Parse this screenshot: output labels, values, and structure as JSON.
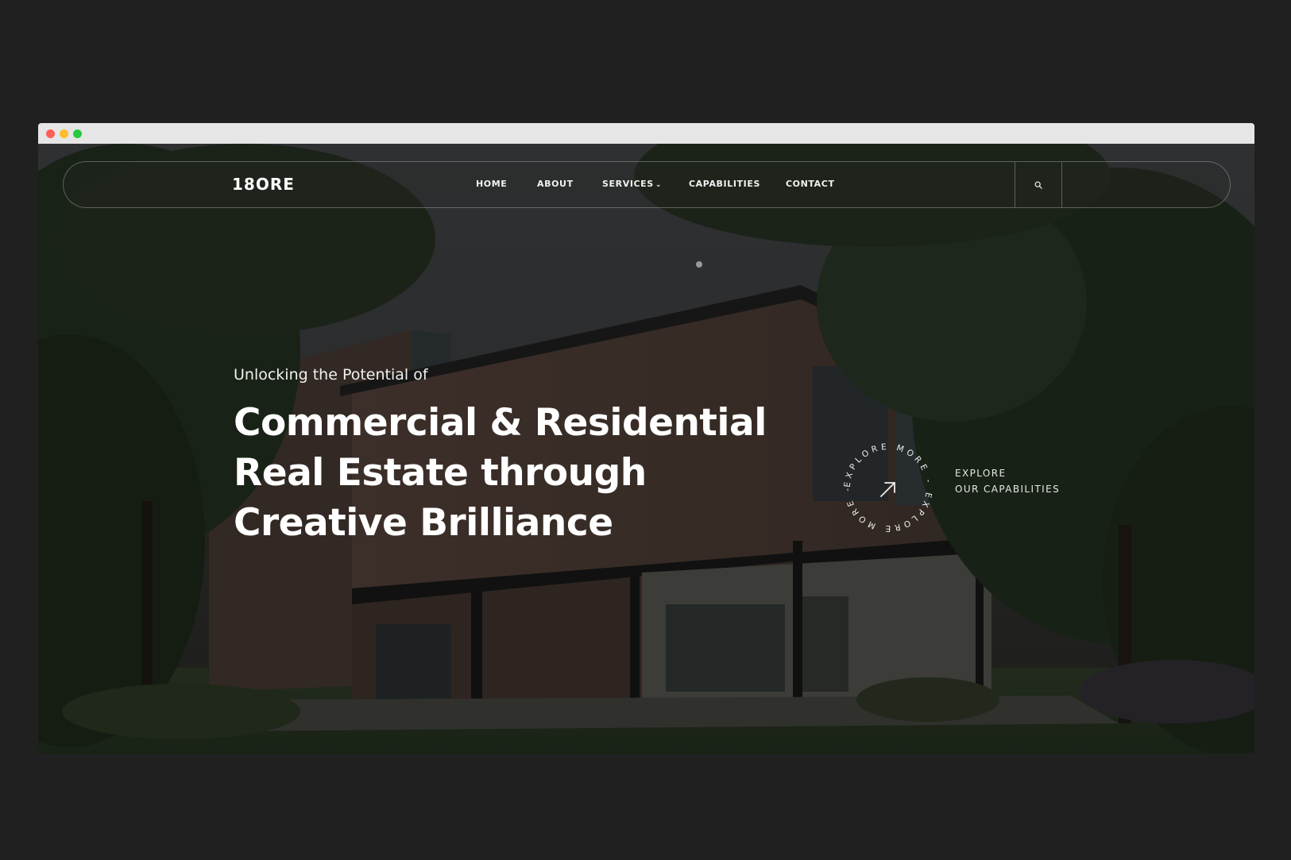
{
  "window": {
    "controls": [
      "close",
      "minimize",
      "maximize"
    ]
  },
  "nav": {
    "logo": "18ORE",
    "links": [
      {
        "label": "HOME"
      },
      {
        "label": "ABOUT"
      },
      {
        "label": "SERVICES",
        "has_dropdown": true
      },
      {
        "label": "CAPABILITIES"
      },
      {
        "label": "CONTACT"
      }
    ],
    "search_icon": "search-icon"
  },
  "hero": {
    "eyebrow": "Unlocking the Potential of",
    "headline_lines": [
      "Commercial & Residential",
      "Real Estate through",
      "Creative Brilliance"
    ],
    "badge_ring_text": "EXPLORE MORE - EXPLORE MORE -",
    "badge_icon": "arrow-up-right-icon",
    "cta_lines": [
      "EXPLORE",
      "OUR CAPABILITIES"
    ]
  },
  "colors": {
    "page_background": "#202020",
    "titlebar": "#e6e6e6",
    "text": "#ffffff"
  }
}
